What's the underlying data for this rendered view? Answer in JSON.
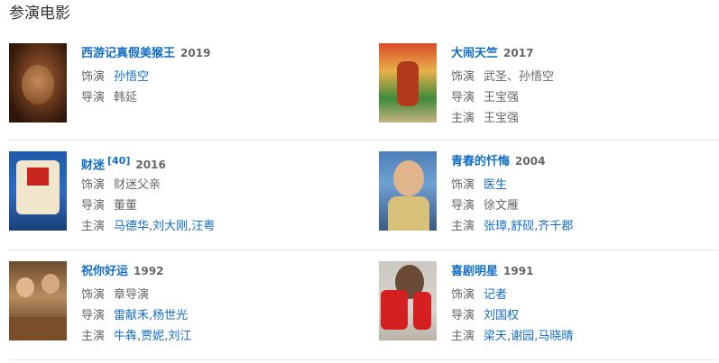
{
  "section_title": "参演电影",
  "labels": {
    "role": "饰演",
    "director": "导演",
    "starring": "主演"
  },
  "movies": [
    {
      "title": "西游记真假美猴王",
      "year": "2019",
      "role": "孙悟空",
      "director": "韩延"
    },
    {
      "title": "大闹天竺",
      "year": "2017",
      "role": "武圣、孙悟空",
      "director": "王宝强",
      "starring": "王宝强"
    },
    {
      "title": "财迷",
      "ref": "[40]",
      "year": "2016",
      "role": "财迷父亲",
      "director": "董董",
      "starring": [
        "马德华",
        "刘大刚",
        "汪粤"
      ]
    },
    {
      "title": "青春的忏悔",
      "year": "2004",
      "role": "医生",
      "director": "徐文雁",
      "starring": [
        "张璋",
        "舒砚",
        "齐千郡"
      ]
    },
    {
      "title": "祝你好运",
      "year": "1992",
      "role": "章导演",
      "director": [
        "雷献禾",
        "杨世光"
      ],
      "starring": [
        "牛犇",
        "贾妮",
        "刘江"
      ]
    },
    {
      "title": "喜剧明星",
      "year": "1991",
      "role": "记者",
      "director": "刘国权",
      "starring": [
        "梁天",
        "谢园",
        "马晓晴"
      ]
    }
  ],
  "separator": ","
}
